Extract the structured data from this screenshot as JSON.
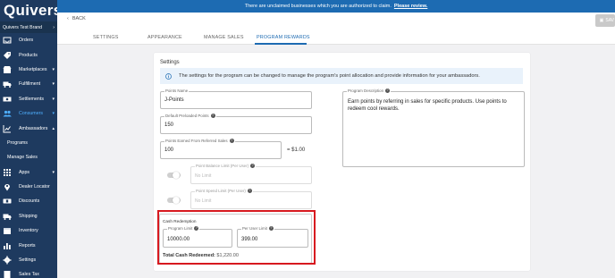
{
  "brand": {
    "name": "Quivers",
    "account": "Quivers Test Brand"
  },
  "banner": {
    "text": "There are unclaimed businesses which you are authorized to claim.",
    "link": "Please review."
  },
  "header": {
    "back_label": "BACK",
    "save_label": "SAV"
  },
  "sidebar": {
    "items": [
      {
        "label": "Orders",
        "icon": "inbox-icon",
        "caret": ""
      },
      {
        "label": "Products",
        "icon": "tag-icon",
        "caret": ""
      },
      {
        "label": "Marketplaces",
        "icon": "store-icon",
        "caret": "▾"
      },
      {
        "label": "Fulfillment",
        "icon": "truck-icon",
        "caret": "▾"
      },
      {
        "label": "Settlements",
        "icon": "money-icon",
        "caret": "▾"
      },
      {
        "label": "Consumers",
        "icon": "users-icon",
        "caret": "▾"
      },
      {
        "label": "Ambassadors",
        "icon": "chart-icon",
        "caret": "▴"
      }
    ],
    "sub_items": [
      {
        "label": "Programs"
      },
      {
        "label": "Manage Sales"
      }
    ],
    "items2": [
      {
        "label": "Apps",
        "icon": "grid-icon",
        "caret": "▾"
      },
      {
        "label": "Dealer Locator",
        "icon": "pin-icon",
        "caret": ""
      },
      {
        "label": "Discounts",
        "icon": "ticket-icon",
        "caret": ""
      },
      {
        "label": "Shipping",
        "icon": "truck-icon",
        "caret": ""
      },
      {
        "label": "Inventory",
        "icon": "box-icon",
        "caret": ""
      },
      {
        "label": "Reports",
        "icon": "bar-chart-icon",
        "caret": ""
      },
      {
        "label": "Settings",
        "icon": "gear-icon",
        "caret": ""
      },
      {
        "label": "Sales Tax",
        "icon": "tax-icon",
        "caret": ""
      }
    ]
  },
  "tabs": [
    {
      "label": "SETTINGS"
    },
    {
      "label": "APPEARANCE"
    },
    {
      "label": "MANAGE SALES"
    },
    {
      "label": "PROGRAM REWARDS"
    }
  ],
  "settings": {
    "title": "Settings",
    "info": "The settings for the program can be changed to manage the program's point allocation and provide information for your ambassadors.",
    "points_name": {
      "label": "Points Name",
      "value": "J-Points"
    },
    "default_points": {
      "label": "Default Preloaded Points",
      "value": "150"
    },
    "points_earned": {
      "label": "Points Earned From Referred Sales",
      "value": "100"
    },
    "ratio": "= $1.00",
    "balance_limit": {
      "label": "Point Balance Limit (Per User)",
      "placeholder": "No Limit"
    },
    "spend_limit": {
      "label": "Point Spend Limit (Per User)",
      "placeholder": "No Limit"
    },
    "description": {
      "label": "Program Description",
      "value": "Earn points by referring in sales for specific products. Use points to redeem cool rewards."
    },
    "cash": {
      "title": "Cash Redemption",
      "program_limit": {
        "label": "Program Limit",
        "value": "10000.00"
      },
      "per_user_limit": {
        "label": "Per User Limit",
        "value": "399.00"
      },
      "total_label": "Total Cash Redeemed:",
      "total_value": "$1,220.00"
    }
  },
  "colors": {
    "sidebar": "#1e3a5f",
    "banner": "#1d6bb2",
    "accent": "#1d6bb2",
    "highlight": "#d7191f"
  }
}
